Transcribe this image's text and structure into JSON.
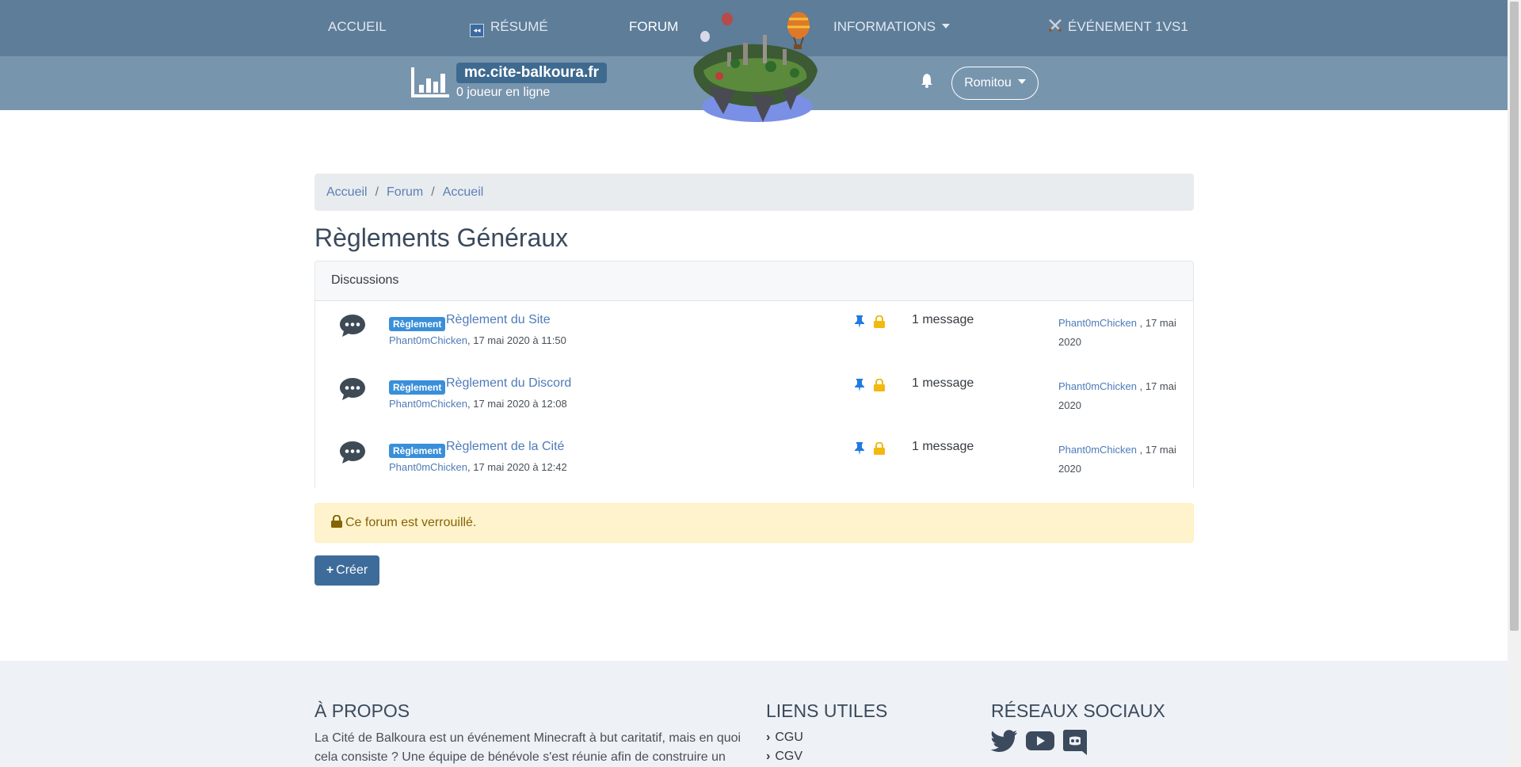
{
  "topnav": {
    "items": [
      {
        "label": "ACCUEIL"
      },
      {
        "label": "RÉSUMÉ"
      },
      {
        "label": "FORUM"
      },
      {
        "label": "INFORMATIONS"
      },
      {
        "label": "ÉVÉNEMENT 1VS1"
      }
    ],
    "active": "FORUM"
  },
  "server": {
    "address": "mc.cite-balkoura.fr",
    "online": "0 joueur en ligne"
  },
  "user": {
    "name": "Romitou"
  },
  "breadcrumb": [
    "Accueil",
    "Forum",
    "Accueil"
  ],
  "page_title": "Règlements Généraux",
  "discussions": {
    "header": "Discussions",
    "topics": [
      {
        "badge": "Règlement",
        "title": "Règlement du Site",
        "author": "Phant0mChicken",
        "date": ", 17 mai 2020 à 11:50",
        "messages": "1 message",
        "last_author": "Phant0mChicken",
        "last_date": " , 17 mai 2020"
      },
      {
        "badge": "Règlement",
        "title": "Règlement du Discord",
        "author": "Phant0mChicken",
        "date": ", 17 mai 2020 à 12:08",
        "messages": "1 message",
        "last_author": "Phant0mChicken",
        "last_date": " , 17 mai 2020"
      },
      {
        "badge": "Règlement",
        "title": "Règlement de la Cité",
        "author": "Phant0mChicken",
        "date": ", 17 mai 2020 à 12:42",
        "messages": "1 message",
        "last_author": "Phant0mChicken",
        "last_date": " , 17 mai 2020"
      }
    ]
  },
  "locked_notice": "Ce forum est verrouillé.",
  "create_button": "Créer",
  "footer": {
    "about_title": "À PROPOS",
    "about_text": "La Cité de Balkoura est un événement Minecraft à but caritatif, mais en quoi cela consiste ? Une équipe de bénévole s'est réunie afin de construire un",
    "links_title": "LIENS UTILES",
    "links": [
      "CGU",
      "CGV"
    ],
    "social_title": "RÉSEAUX SOCIAUX",
    "social": [
      "twitter-icon",
      "youtube-icon",
      "discord-icon"
    ]
  },
  "colors": {
    "topnav_bg": "#5d7d99",
    "serverbar_bg": "#7895ae",
    "badge": "#3a8fd9",
    "pin": "#1f7be0",
    "lock": "#f2b90f",
    "alert_bg": "#fff3cd"
  }
}
